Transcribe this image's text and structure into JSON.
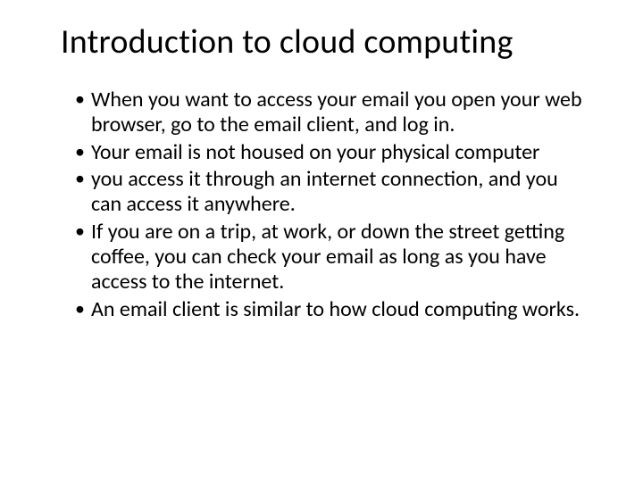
{
  "slide": {
    "title": "Introduction to cloud computing",
    "bullets": [
      " When you want to access your email you open your web browser, go to the email client, and log in.",
      "Your email is not housed on your physical computer",
      " you access it through an internet connection, and you can access it anywhere.",
      "If you are on a trip, at work, or down the street getting coffee, you can check your email as long as you have access to the internet.",
      " An email client is similar to how cloud computing works."
    ]
  }
}
